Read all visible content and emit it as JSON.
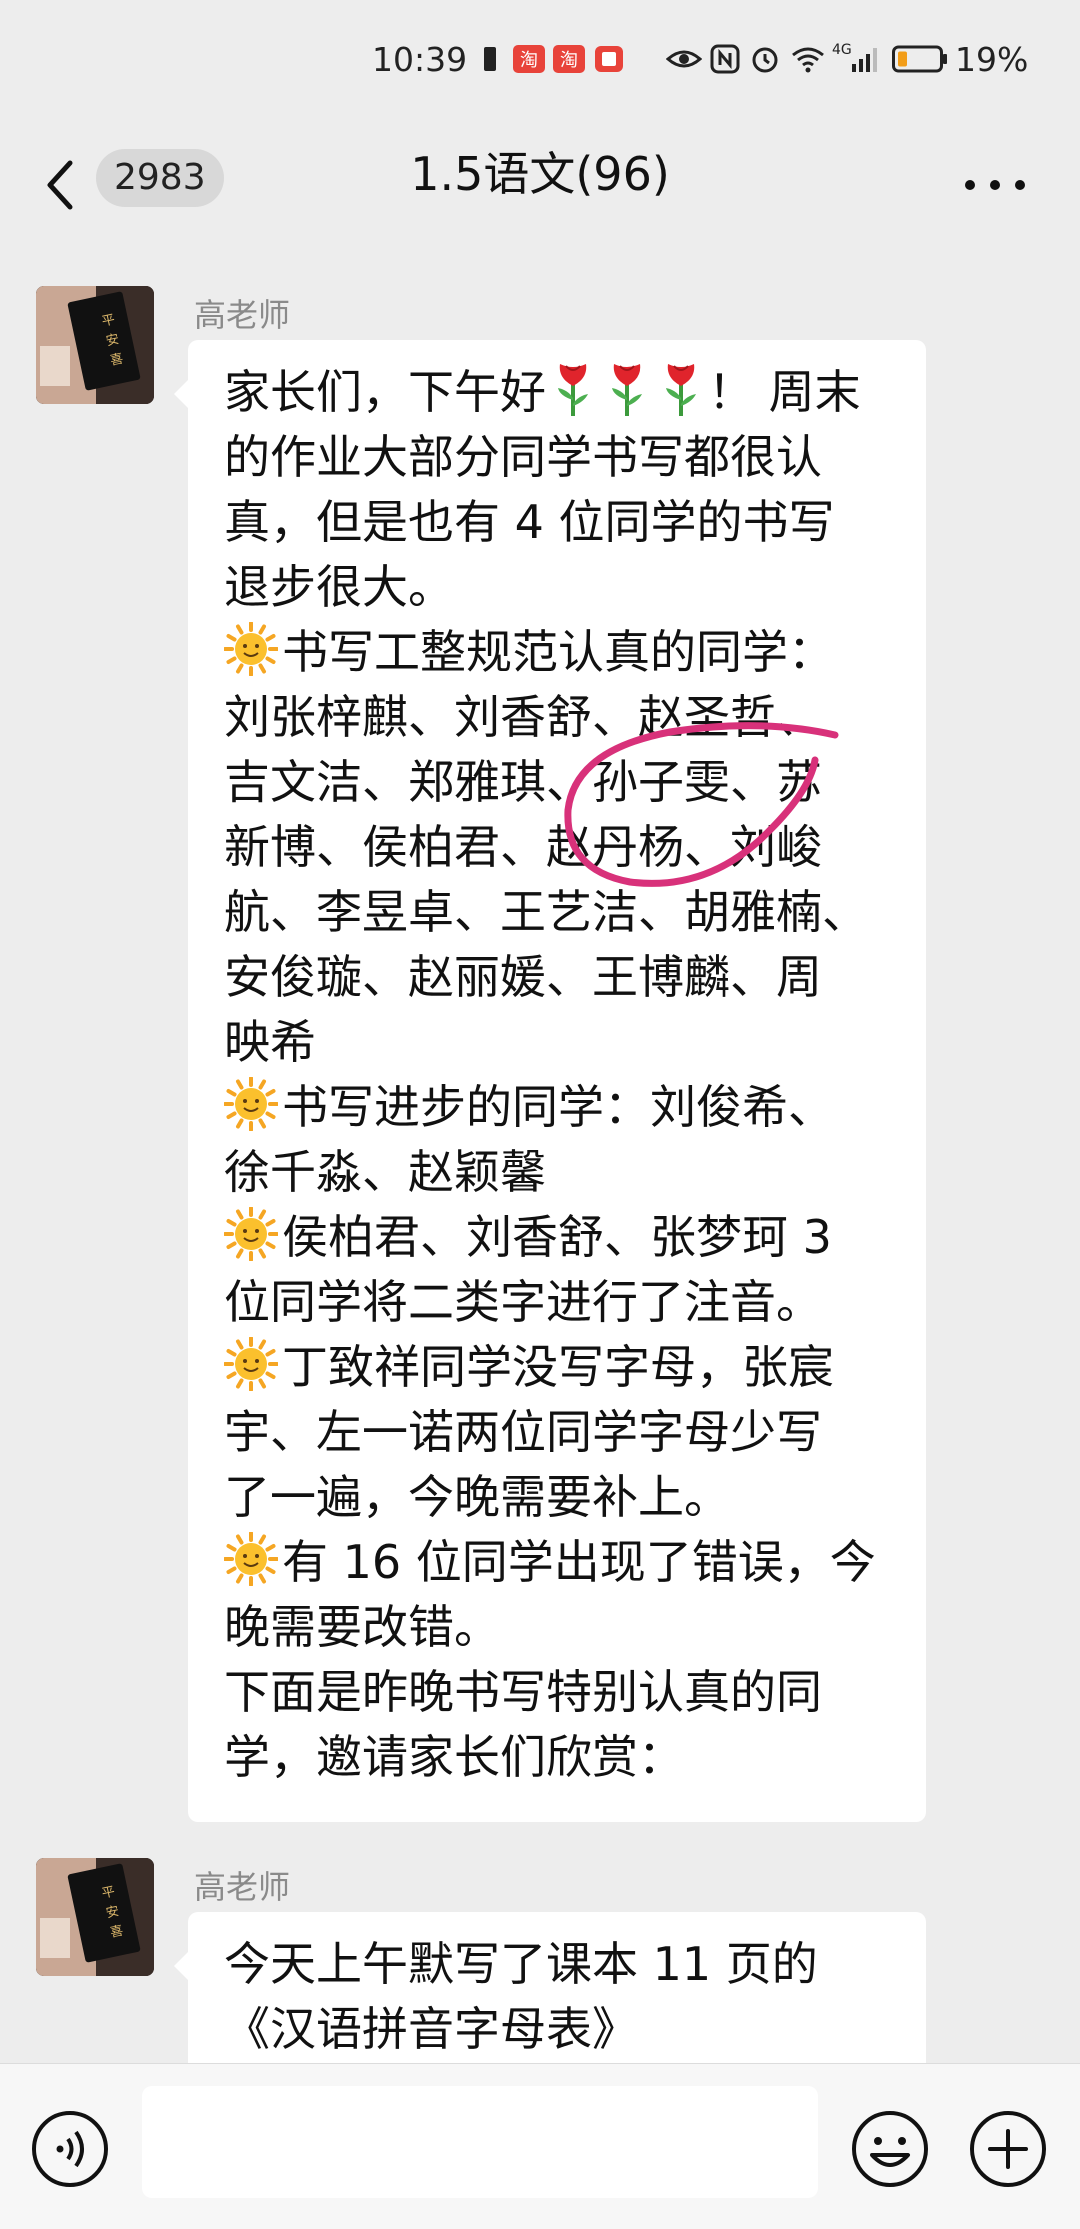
{
  "status_bar": {
    "time": "10:39",
    "battery": "19%",
    "network": "4G",
    "icons": [
      "sim-icon",
      "taobao-icon",
      "taobao-icon",
      "notification-icon",
      "eye-icon",
      "nfc-icon",
      "alarm-icon",
      "wifi-icon",
      "signal-icon",
      "battery-icon"
    ]
  },
  "header": {
    "unread_count": "2983",
    "title": "1.5语文(96)"
  },
  "messages": [
    {
      "sender": "高老师",
      "lines": [
        {
          "text": "家长们，下午好",
          "after": "！ 周末",
          "roses": 3
        },
        {
          "text": "的作业大部分同学书写都很认"
        },
        {
          "text": "真，但是也有 4 位同学的书写"
        },
        {
          "text": "退步很大。"
        },
        {
          "text": "书写工整规范认真的同学：",
          "sun": true
        },
        {
          "text": "刘张梓麒、刘香舒、赵圣哲、"
        },
        {
          "text": "吉文洁、郑雅琪、孙子雯、苏"
        },
        {
          "text": "新博、侯柏君、赵丹杨、刘峻"
        },
        {
          "text": "航、李昱卓、王艺洁、胡雅楠、"
        },
        {
          "text": "安俊璇、赵丽媛、王博麟、周"
        },
        {
          "text": "映希"
        },
        {
          "text": "书写进步的同学：刘俊希、",
          "sun": true
        },
        {
          "text": "徐千淼、赵颖馨"
        },
        {
          "text": "侯柏君、刘香舒、张梦珂 3",
          "sun": true
        },
        {
          "text": "位同学将二类字进行了注音。"
        },
        {
          "text": "丁致祥同学没写字母，张宸",
          "sun": true
        },
        {
          "text": "宇、左一诺两位同学字母少写"
        },
        {
          "text": "了一遍，今晚需要补上。"
        },
        {
          "text": "有 16 位同学出现了错误，今",
          "sun": true
        },
        {
          "text": "晚需要改错。"
        },
        {
          "text": "下面是昨晚书写特别认真的同"
        },
        {
          "text": "学，邀请家长们欣赏："
        }
      ]
    },
    {
      "sender": "高老师",
      "lines": [
        {
          "text": "今天上午默写了课本 11 页的"
        },
        {
          "text": "《汉语拼音字母表》"
        }
      ]
    }
  ],
  "input": {
    "placeholder": ""
  },
  "colors": {
    "background": "#ededed",
    "bubble": "#ffffff",
    "annotation": "#d8317a"
  }
}
